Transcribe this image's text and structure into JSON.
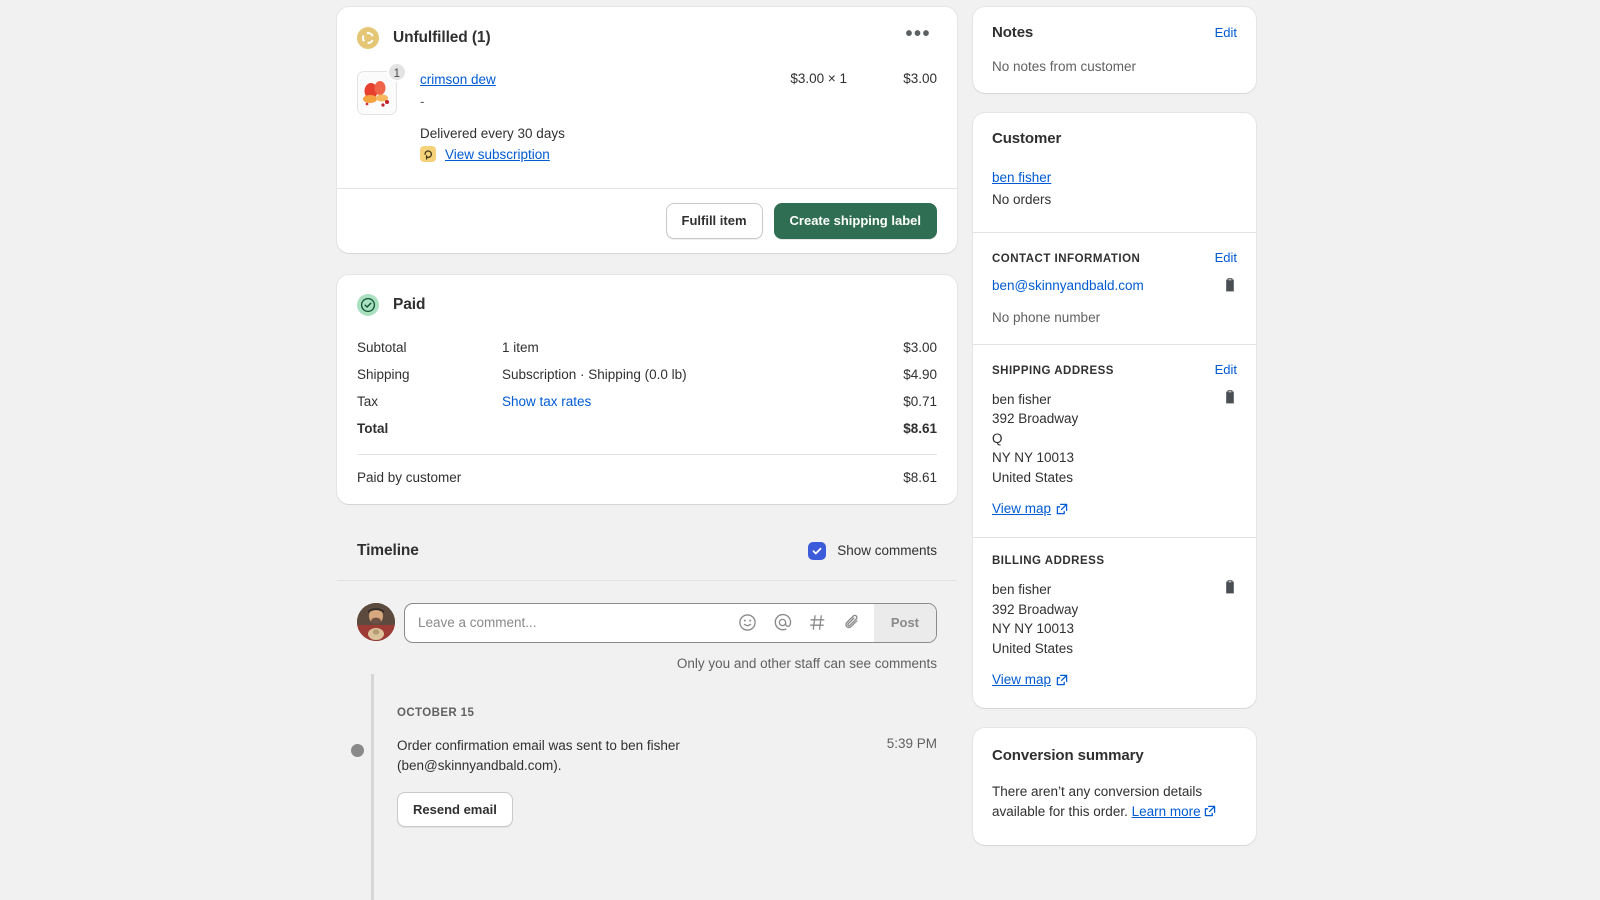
{
  "fulfillment": {
    "status_icon": "unfulfilled-circle-icon",
    "title": "Unfulfilled (1)",
    "menu_icon": "kebab-menu-icon",
    "line_item": {
      "quantity_badge": "1",
      "thumbnail_icon": "product-thumbnail",
      "name": "crimson dew",
      "variant": "-",
      "subscription_text": "Delivered every 30 days",
      "subscription_icon": "subscription-badge-icon",
      "subscription_link": "View subscription",
      "unit_price": "$3.00 × 1",
      "line_total": "$3.00"
    },
    "actions": {
      "secondary": "Fulfill item",
      "primary": "Create shipping label"
    }
  },
  "payment": {
    "status_icon": "paid-check-icon",
    "title": "Paid",
    "rows": [
      {
        "label": "Subtotal",
        "detail": "1 item",
        "detail_is_link": false,
        "amount": "$3.00"
      },
      {
        "label": "Shipping",
        "detail": "Subscription · Shipping (0.0 lb)",
        "detail_is_link": false,
        "amount": "$4.90"
      },
      {
        "label": "Tax",
        "detail": "Show tax rates",
        "detail_is_link": true,
        "amount": "$0.71"
      },
      {
        "label": "Total",
        "detail": "",
        "detail_is_link": false,
        "amount": "$8.61"
      }
    ],
    "footer_label": "Paid by customer",
    "footer_amount": "$8.61"
  },
  "timeline": {
    "title": "Timeline",
    "show_comments_label": "Show comments",
    "show_comments_checked": true,
    "composer": {
      "placeholder": "Leave a comment...",
      "value": "",
      "emoji_icon": "emoji-icon",
      "mention_icon": "mention-icon",
      "hashtag_icon": "hashtag-icon",
      "attach_icon": "paperclip-icon",
      "post_label": "Post",
      "avatar_icon": "staff-avatar"
    },
    "hint": "Only you and other staff can see comments",
    "date_group": "OCTOBER 15",
    "events": [
      {
        "text": "Order confirmation email was sent to ben fisher (ben@skinnyandbald.com).",
        "time": "5:39 PM",
        "action_label": "Resend email"
      }
    ]
  },
  "notes": {
    "title": "Notes",
    "edit_label": "Edit",
    "empty_text": "No notes from customer"
  },
  "customer": {
    "title": "Customer",
    "name": "ben fisher",
    "orders_text": "No orders",
    "contact": {
      "heading": "CONTACT INFORMATION",
      "edit_label": "Edit",
      "email": "ben@skinnyandbald.com",
      "phone": "No phone number",
      "copy_icon": "copy-icon"
    },
    "shipping": {
      "heading": "SHIPPING ADDRESS",
      "edit_label": "Edit",
      "lines": [
        "ben fisher",
        "392 Broadway",
        "Q",
        "NY NY 10013",
        "United States"
      ],
      "map_label": "View map",
      "map_icon": "external-link-icon",
      "copy_icon": "copy-icon"
    },
    "billing": {
      "heading": "BILLING ADDRESS",
      "lines": [
        "ben fisher",
        "392 Broadway",
        "NY NY 10013",
        "United States"
      ],
      "map_label": "View map",
      "map_icon": "external-link-icon",
      "copy_icon": "copy-icon"
    }
  },
  "conversion": {
    "title": "Conversion summary",
    "text": "There aren’t any conversion details available for this order.",
    "link_label": "Learn more",
    "link_icon": "external-link-icon"
  },
  "colors": {
    "page_bg": "#f1f1f1",
    "card_bg": "#ffffff",
    "link": "#005bd3",
    "primary_button": "#2f6e52",
    "checkbox": "#3b5bdb",
    "unfulfilled_badge": "#e5c675",
    "paid_badge": "#a9e0c0"
  }
}
